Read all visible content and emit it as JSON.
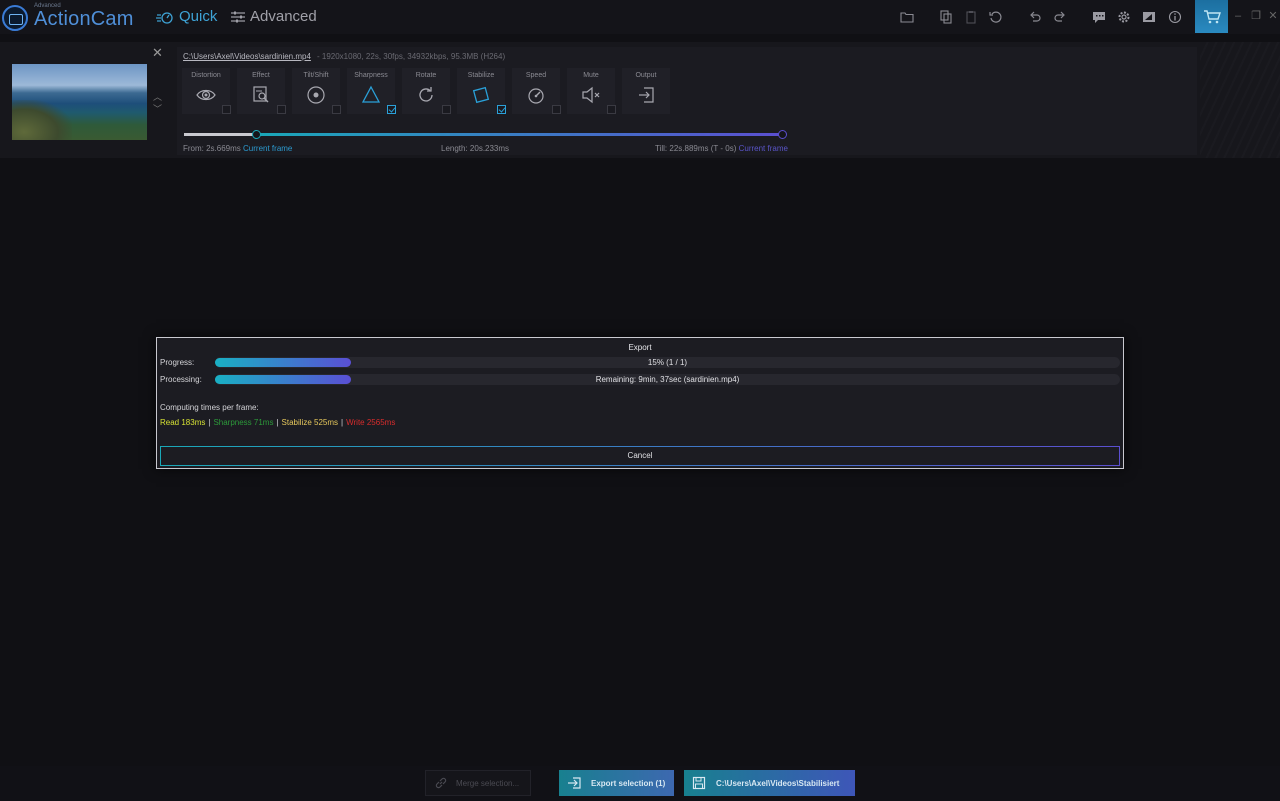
{
  "app": {
    "brand_small": "Advanced",
    "brand_big": "ActionCam",
    "modes": {
      "quick": "Quick",
      "advanced": "Advanced"
    }
  },
  "clip": {
    "file_path": "C:\\Users\\Axel\\Videos\\sardinien.mp4",
    "file_meta": "-  1920x1080, 22s, 30fps, 34932kbps, 95.3MB (H264)",
    "tools": [
      {
        "label": "Distortion",
        "icon": "eye-icon",
        "checked": false
      },
      {
        "label": "Effect",
        "icon": "effect-icon",
        "checked": false
      },
      {
        "label": "Tilt/Shift",
        "icon": "tiltshift-icon",
        "checked": false
      },
      {
        "label": "Sharpness",
        "icon": "triangle-icon",
        "checked": true
      },
      {
        "label": "Rotate",
        "icon": "rotate-icon",
        "checked": false
      },
      {
        "label": "Stabilize",
        "icon": "stabilize-icon",
        "checked": true
      },
      {
        "label": "Speed",
        "icon": "speedometer-icon",
        "checked": false
      },
      {
        "label": "Mute",
        "icon": "mute-icon",
        "checked": false
      },
      {
        "label": "Output",
        "icon": "output-icon",
        "checked": false
      }
    ],
    "range": {
      "from_text": "From: 2s.669ms",
      "from_link": "Current frame",
      "length_text": "Length: 20s.233ms",
      "till_text": "Till: 22s.889ms (T - 0s)",
      "till_link": "Current frame"
    }
  },
  "export_dialog": {
    "title": "Export",
    "progress_label": "Progress:",
    "progress_text": "15% (1 / 1)",
    "progress_value": 0.15,
    "processing_label": "Processing:",
    "processing_text": "Remaining: 9min, 37sec (sardinien.mp4)",
    "processing_value": 0.15,
    "computing_label": "Computing times per frame:",
    "times": {
      "read": "Read 183ms",
      "sharpness": "Sharpness 71ms",
      "stabilize": "Stabilize 525ms",
      "write": "Write 2565ms"
    },
    "cancel_label": "Cancel"
  },
  "bottom": {
    "merge_label": "Merge selection...",
    "export_label": "Export selection (1)",
    "output_path": "C:\\Users\\Axel\\Videos\\Stabilisiert"
  },
  "colors": {
    "accent_teal": "#1aa8b8",
    "accent_purple": "#5b4fd0",
    "read": "#d6e234",
    "sharpness": "#2c9a3a",
    "stabilize": "#e6c85c",
    "write": "#d82c2c"
  }
}
